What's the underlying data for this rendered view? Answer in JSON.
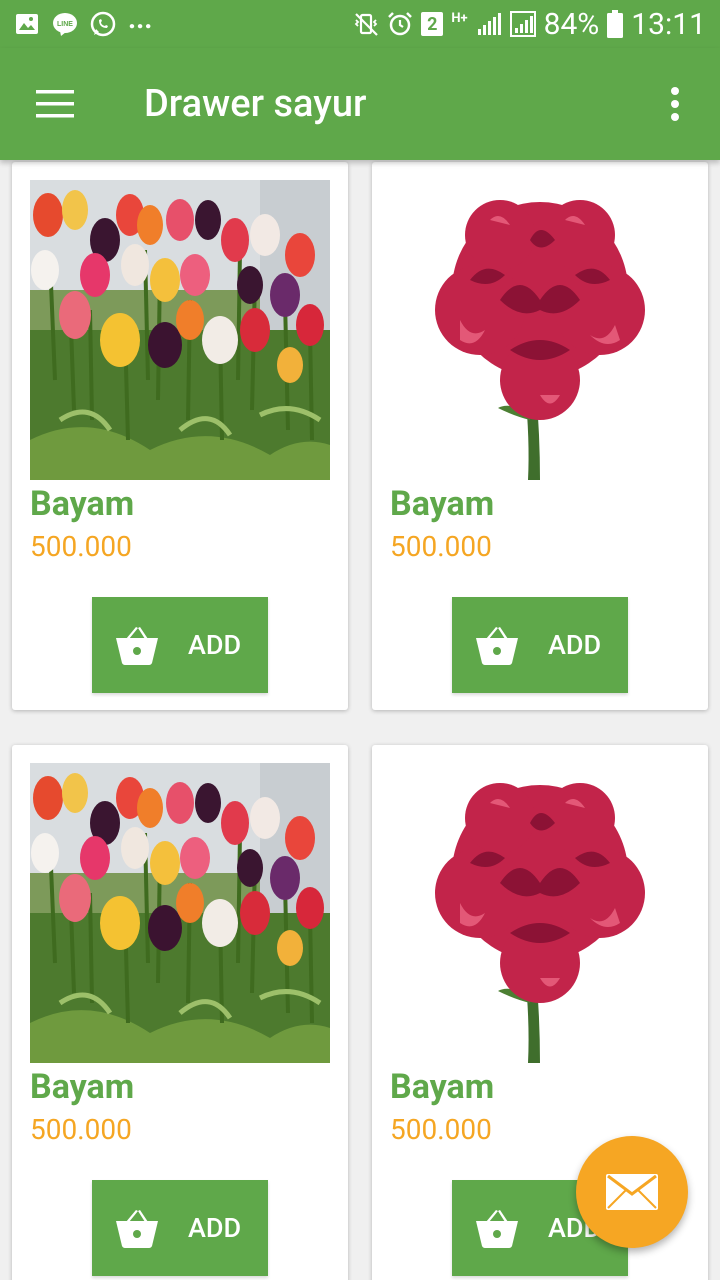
{
  "status_bar": {
    "more": "...",
    "sim_badge": "2",
    "network": "H+",
    "battery": "84%",
    "time": "13:11"
  },
  "app_bar": {
    "title": "Drawer sayur"
  },
  "products": [
    {
      "name": "Bayam",
      "price": "500.000",
      "button": "ADD",
      "image": "tulip-field"
    },
    {
      "name": "Bayam",
      "price": "500.000",
      "button": "ADD",
      "image": "red-carnation"
    },
    {
      "name": "Bayam",
      "price": "500.000",
      "button": "ADD",
      "image": "tulip-field"
    },
    {
      "name": "Bayam",
      "price": "500.000",
      "button": "ADD",
      "image": "red-carnation"
    }
  ],
  "colors": {
    "primary": "#5fa84a",
    "price": "#f5a623",
    "fab": "#f6a623"
  },
  "fab": {
    "icon": "mail-icon"
  }
}
